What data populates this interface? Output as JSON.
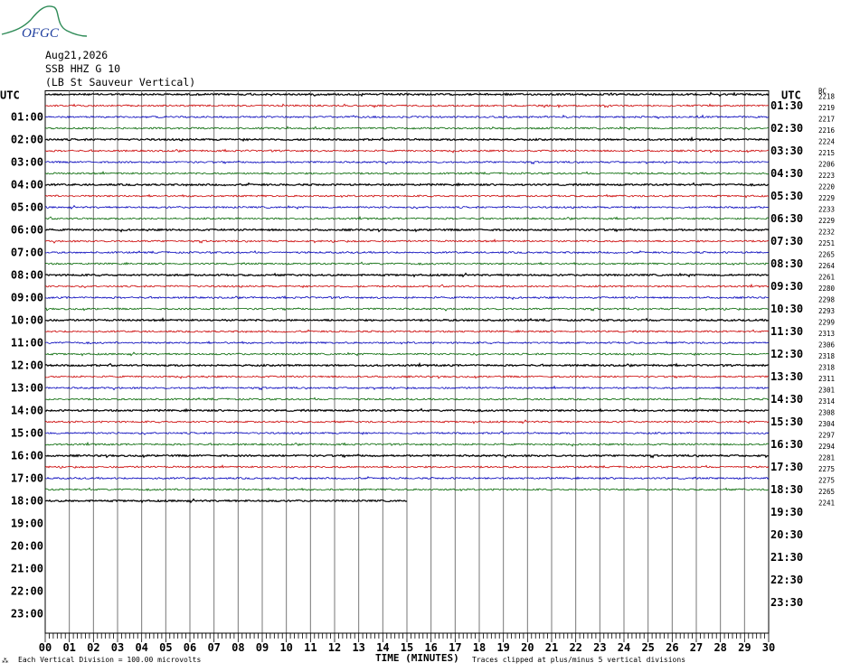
{
  "logo": {
    "text": "OFGC",
    "colors": {
      "curve": "#2e8b57",
      "text": "#1f3f9f"
    }
  },
  "header": {
    "date": "Aug21,2026",
    "station": "SSB HHZ G 10",
    "location": "(LB St Sauveur Vertical)"
  },
  "chart_data": {
    "type": "line",
    "kind": "seismogram-helicorder",
    "left_axis_title": "UTC",
    "right_axis_title": "UTC",
    "right_corner_label": "BC",
    "left_hour_labels": [
      "01:00",
      "02:00",
      "03:00",
      "04:00",
      "05:00",
      "06:00",
      "07:00",
      "08:00",
      "09:00",
      "10:00",
      "11:00",
      "12:00",
      "13:00",
      "14:00",
      "15:00",
      "16:00",
      "17:00",
      "18:00",
      "19:00",
      "20:00",
      "21:00",
      "22:00",
      "23:00"
    ],
    "right_hour_labels": [
      "01:30",
      "02:30",
      "03:30",
      "04:30",
      "05:30",
      "06:30",
      "07:30",
      "08:30",
      "09:30",
      "10:30",
      "11:30",
      "12:30",
      "13:30",
      "14:30",
      "15:30",
      "16:30",
      "17:30",
      "18:30",
      "19:30",
      "20:30",
      "21:30",
      "22:30",
      "23:30"
    ],
    "x_tick_labels": [
      "00",
      "01",
      "02",
      "03",
      "04",
      "05",
      "06",
      "07",
      "08",
      "09",
      "10",
      "11",
      "12",
      "13",
      "14",
      "15",
      "16",
      "17",
      "18",
      "19",
      "20",
      "21",
      "22",
      "23",
      "24",
      "25",
      "26",
      "27",
      "28",
      "29",
      "30"
    ],
    "x_label": "TIME (MINUTES)",
    "xlim": [
      0,
      30
    ],
    "traces_per_hour": 2,
    "total_rows": 48,
    "rows_with_data": 37,
    "last_row_end_minute": 15,
    "trace_colors": [
      "#000000",
      "#cc0000",
      "#0000bb",
      "#006600"
    ],
    "trace_counts": [
      2218,
      2219,
      2217,
      2216,
      2224,
      2215,
      2206,
      2223,
      2220,
      2229,
      2233,
      2229,
      2232,
      2251,
      2265,
      2264,
      2261,
      2280,
      2298,
      2293,
      2299,
      2313,
      2306,
      2318,
      2318,
      2311,
      2301,
      2314,
      2308,
      2304,
      2297,
      2294,
      2281,
      2275,
      2275,
      2265,
      2241
    ],
    "footer_left_mark": "⁂",
    "footer_scale": "Each Vertical Division =  100.00 microvolts",
    "footer_clip": "Traces clipped at plus/minus 5 vertical divisions"
  }
}
